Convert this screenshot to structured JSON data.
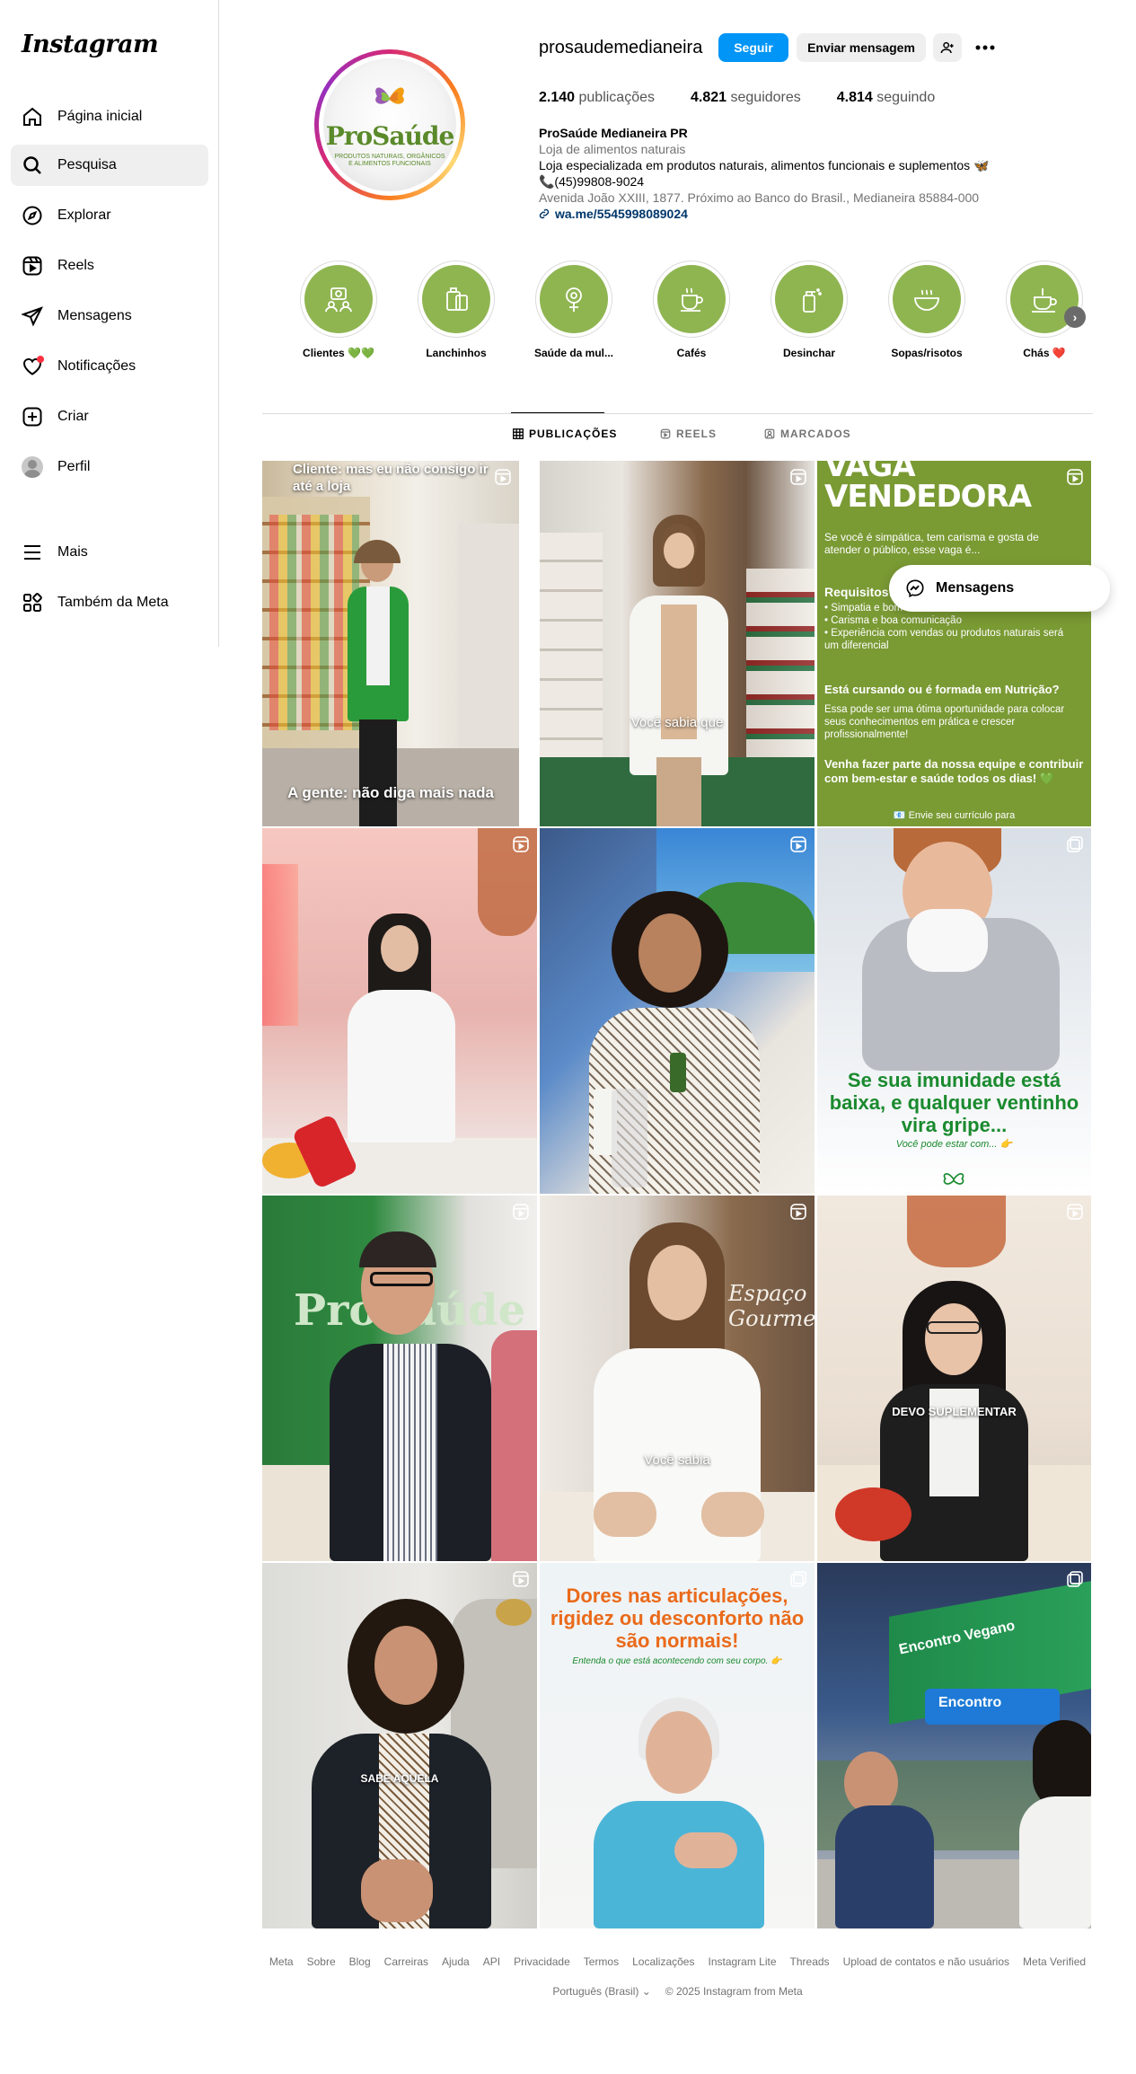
{
  "app": {
    "logo": "Instagram"
  },
  "sidebar": {
    "items": [
      {
        "label": "Página inicial",
        "icon": "home-icon"
      },
      {
        "label": "Pesquisa",
        "icon": "search-icon"
      },
      {
        "label": "Explorar",
        "icon": "compass-icon"
      },
      {
        "label": "Reels",
        "icon": "reels-icon"
      },
      {
        "label": "Mensagens",
        "icon": "send-icon"
      },
      {
        "label": "Notificações",
        "icon": "heart-icon"
      },
      {
        "label": "Criar",
        "icon": "plus-square-icon"
      },
      {
        "label": "Perfil",
        "icon": "avatar"
      },
      {
        "label": "Mais",
        "icon": "menu-icon"
      },
      {
        "label": "Também da Meta",
        "icon": "meta-apps-icon"
      }
    ]
  },
  "profile": {
    "username": "prosaudemedianeira",
    "follow_label": "Seguir",
    "message_label": "Enviar mensagem",
    "stats": {
      "posts_count": "2.140",
      "posts_label": "publicações",
      "followers_count": "4.821",
      "followers_label": "seguidores",
      "following_count": "4.814",
      "following_label": "seguindo"
    },
    "bio": {
      "name": "ProSaúde Medianeira PR",
      "category": "Loja de alimentos naturais",
      "line1": "Loja especializada em produtos naturais, alimentos funcionais e suplementos 🦋",
      "phone": "📞(45)99808-9024",
      "address": "Avenida João XXIII, 1877. Próximo ao Banco do Brasil., Medianeira 85884-000",
      "link": "wa.me/5545998089024"
    },
    "pic": {
      "brand": "ProSaúde",
      "tagline": "PRODUTOS NATURAIS, ORGÂNICOS E ALIMENTOS FUNCIONAIS"
    }
  },
  "highlights": [
    {
      "label": "Clientes 💚💚",
      "icon": "people-icon"
    },
    {
      "label": "Lanchinhos",
      "icon": "snack-icon"
    },
    {
      "label": "Saúde da mul...",
      "icon": "female-icon"
    },
    {
      "label": "Cafés",
      "icon": "coffee-icon"
    },
    {
      "label": "Desinchar",
      "icon": "spray-icon"
    },
    {
      "label": "Sopas/risotos",
      "icon": "bowl-icon"
    },
    {
      "label": "Chás ❤️",
      "icon": "tea-icon"
    }
  ],
  "tabs": [
    {
      "label": "PUBLICAÇÕES",
      "icon": "grid-icon"
    },
    {
      "label": "REELS",
      "icon": "reels-icon"
    },
    {
      "label": "MARCADOS",
      "icon": "tagged-icon"
    }
  ],
  "posts": {
    "p1": {
      "top_caption": "Cliente: mas eu não consigo ir até a loja",
      "bottom_caption": "A gente: não diga mais nada"
    },
    "p2": {
      "caption": "Você sabia que"
    },
    "p3": {
      "title1": "VAGA",
      "title2": "VENDEDORA",
      "intro": "Se você é simpática, tem carisma e gosta de atender o público, esse vaga é...",
      "req_title": "Requisitos:",
      "req1": "• Simpatia e bom atendimento",
      "req2": "• Carisma e boa comunicação",
      "req3": "• Experiência com vendas ou produtos naturais será um diferencial",
      "q": "Está cursando ou é formada em Nutrição?",
      "q_text": "Essa pode ser uma ótima oportunidade para colocar seus conhecimentos em prática e crescer profissionalmente!",
      "cta": "Venha fazer parte da nossa equipe e contribuir com bem-estar e saúde todos os dias! 💚",
      "footer": "📧 Envie seu currículo para"
    },
    "p6": {
      "headline": "Se sua imunidade está baixa, e qualquer ventinho vira gripe...",
      "sub": "Você pode estar com... 👉"
    },
    "p7": {
      "brand": "ProSaúde"
    },
    "p8": {
      "caption": "Você sabia",
      "sign": "Espaço Gourmet"
    },
    "p9": {
      "caption": "DEVO SUPLEMENTAR"
    },
    "p10": {
      "caption": "SABE AQUELA"
    },
    "p11": {
      "headline": "Dores nas articulações, rigidez ou desconforto não são normais!",
      "sub": "Entenda o que está acontecendo com seu corpo. 👉"
    },
    "p12": {
      "sign1": "Encontro Vegano",
      "sign2": "Encontro"
    }
  },
  "floating": {
    "messages_label": "Mensagens"
  },
  "footer": {
    "links": [
      "Meta",
      "Sobre",
      "Blog",
      "Carreiras",
      "Ajuda",
      "API",
      "Privacidade",
      "Termos",
      "Localizações",
      "Instagram Lite",
      "Threads",
      "Upload de contatos e não usuários",
      "Meta Verified"
    ],
    "language": "Português (Brasil) ⌄",
    "copyright": "© 2025 Instagram from Meta"
  },
  "colors": {
    "follow_blue": "#0095f6",
    "highlight_green": "#8fb551",
    "notif_red": "#ff3040",
    "brand_green": "#7a9a34",
    "headline_green": "#1a8a2e",
    "headline_orange": "#ea6a1a"
  }
}
